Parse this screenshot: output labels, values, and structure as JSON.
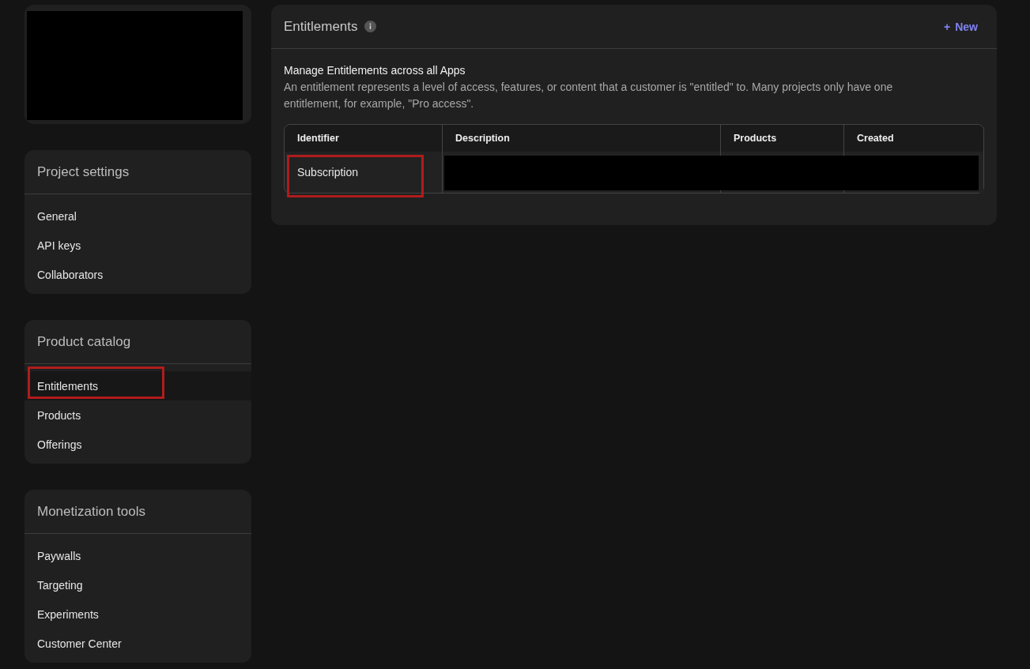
{
  "sidebar": {
    "top_card": {
      "redacted": true
    },
    "sections": [
      {
        "title": "Project settings",
        "items": [
          {
            "label": "General",
            "selected": false,
            "highlighted": false
          },
          {
            "label": "API keys",
            "selected": false,
            "highlighted": false
          },
          {
            "label": "Collaborators",
            "selected": false,
            "highlighted": false
          }
        ]
      },
      {
        "title": "Product catalog",
        "items": [
          {
            "label": "Entitlements",
            "selected": true,
            "highlighted": true
          },
          {
            "label": "Products",
            "selected": false,
            "highlighted": false
          },
          {
            "label": "Offerings",
            "selected": false,
            "highlighted": false
          }
        ]
      },
      {
        "title": "Monetization tools",
        "items": [
          {
            "label": "Paywalls",
            "selected": false,
            "highlighted": false
          },
          {
            "label": "Targeting",
            "selected": false,
            "highlighted": false
          },
          {
            "label": "Experiments",
            "selected": false,
            "highlighted": false
          },
          {
            "label": "Customer Center",
            "selected": false,
            "highlighted": false
          }
        ]
      }
    ]
  },
  "panel": {
    "title": "Entitlements",
    "new_button": {
      "icon": "+",
      "label": "New"
    },
    "heading": "Manage Entitlements across all Apps",
    "description": "An entitlement represents a level of access, features, or content that a customer is \"entitled\" to. Many projects only have one entitlement, for example, \"Pro access\".",
    "table": {
      "columns": [
        "Identifier",
        "Description",
        "Products",
        "Created"
      ],
      "rows": [
        {
          "identifier": "Subscription",
          "highlighted": true,
          "rest_redacted": true
        }
      ]
    }
  }
}
